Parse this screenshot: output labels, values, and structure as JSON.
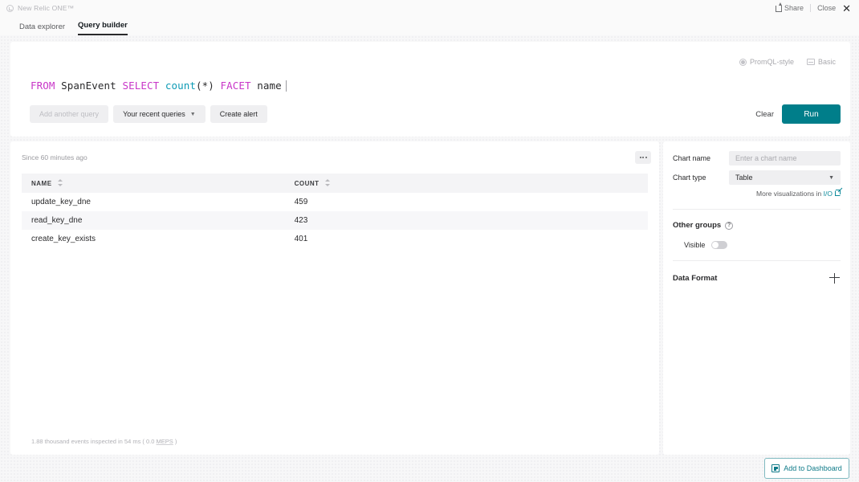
{
  "brand": {
    "name": "New Relic ONE",
    "tm": "™",
    "logo_icon": "newrelic-logo-icon"
  },
  "topbar": {
    "share_label": "Share",
    "share_icon": "share-icon",
    "close_label": "Close",
    "close_icon": "close-x-icon"
  },
  "tabs": [
    {
      "label": "Data explorer",
      "active": false
    },
    {
      "label": "Query builder",
      "active": true
    }
  ],
  "query_card": {
    "modes": [
      {
        "label": "PromQL-style",
        "icon": "promql-circle-icon"
      },
      {
        "label": "Basic",
        "icon": "basic-panel-icon"
      }
    ],
    "query_tokens": [
      {
        "text": "FROM",
        "type": "keyword"
      },
      {
        "text": "SpanEvent",
        "type": "plain"
      },
      {
        "text": "SELECT",
        "type": "keyword"
      },
      {
        "text": "count",
        "type": "function"
      },
      {
        "text": "(*)",
        "type": "plain"
      },
      {
        "text": "FACET",
        "type": "keyword"
      },
      {
        "text": "name",
        "type": "plain"
      }
    ],
    "query_text": "FROM SpanEvent SELECT count(*) FACET name",
    "add_query_label": "Add another query",
    "recent_queries_label": "Your recent queries",
    "recent_queries_chevron": "chevron-down-icon",
    "create_alert_label": "Create alert",
    "clear_label": "Clear",
    "run_label": "Run",
    "run_color": "#007e8a"
  },
  "results": {
    "since_label": "Since 60 minutes ago",
    "overflow_icon": "ellipsis-icon",
    "columns": [
      {
        "label": "NAME",
        "sort_icon": "sort-updown-icon"
      },
      {
        "label": "COUNT",
        "sort_icon": "sort-updown-icon"
      }
    ],
    "rows": [
      {
        "name": "update_key_dne",
        "count": "459"
      },
      {
        "name": "read_key_dne",
        "count": "423"
      },
      {
        "name": "create_key_exists",
        "count": "401"
      }
    ],
    "footer": {
      "prefix": "1.88 thousand events inspected in 54 ms ( 0.0 ",
      "unit": "MEPS",
      "suffix": " )"
    }
  },
  "sidebar": {
    "chart_name_label": "Chart name",
    "chart_name_value": "",
    "chart_name_placeholder": "Enter a chart name",
    "chart_type_label": "Chart type",
    "chart_type_value": "Table",
    "chart_type_chevron": "chevron-down-icon",
    "more_vis_text": "More visualizations in ",
    "more_vis_link": "I/O",
    "more_vis_icon": "external-link-icon",
    "other_groups_label": "Other groups",
    "help_icon": "help-circle-icon",
    "help_glyph": "?",
    "visible_label": "Visible",
    "visible_on": false,
    "data_format_label": "Data Format",
    "add_format_icon": "plus-icon"
  },
  "footer": {
    "add_dashboard_label": "Add to Dashboard",
    "add_dashboard_icon": "dashboard-icon",
    "accent_color": "#0e7a88"
  }
}
